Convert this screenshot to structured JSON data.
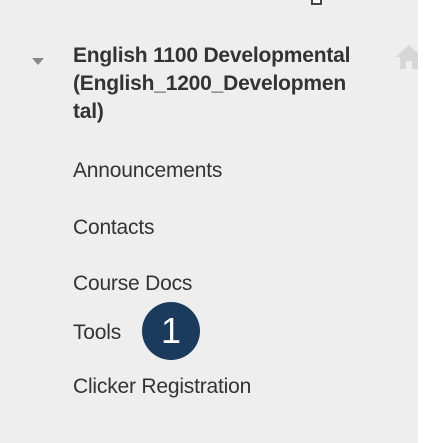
{
  "course": {
    "title_line1": "English 1100 Developmental",
    "title_line2": "(English_1200_Developmen",
    "title_line3": "tal)"
  },
  "menu": {
    "items": [
      {
        "label": "Announcements"
      },
      {
        "label": "Contacts"
      },
      {
        "label": "Course Docs"
      },
      {
        "label": "Tools"
      },
      {
        "label": "Clicker Registration"
      }
    ]
  },
  "callout": {
    "number": "1",
    "color": "#1b3a5c"
  },
  "icons": {
    "collapse": "collapse-arrow-icon",
    "home": "home-icon"
  }
}
